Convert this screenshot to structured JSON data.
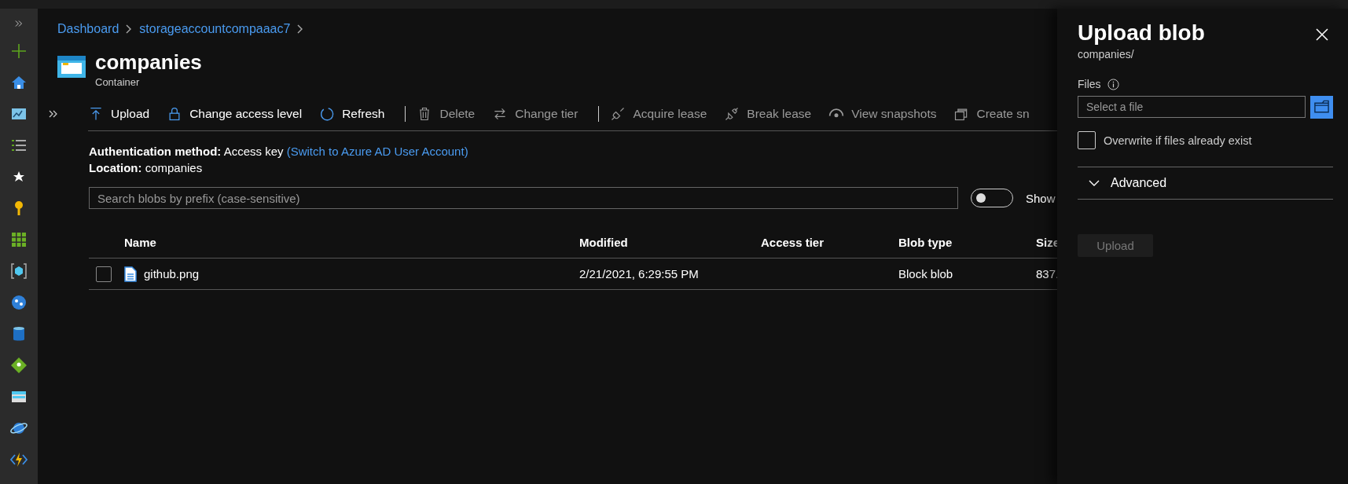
{
  "breadcrumb": [
    "Dashboard",
    "storageaccountcompaaac7"
  ],
  "header": {
    "title": "companies",
    "subtitle": "Container"
  },
  "toolbar": [
    {
      "label": "Upload",
      "disabled": false
    },
    {
      "label": "Change access level",
      "disabled": false
    },
    {
      "label": "Refresh",
      "disabled": false
    },
    {
      "label": "Delete",
      "disabled": true
    },
    {
      "label": "Change tier",
      "disabled": true
    },
    {
      "label": "Acquire lease",
      "disabled": true
    },
    {
      "label": "Break lease",
      "disabled": true
    },
    {
      "label": "View snapshots",
      "disabled": true
    },
    {
      "label": "Create sn",
      "disabled": true
    }
  ],
  "info": {
    "auth_label": "Authentication method:",
    "auth_value": "Access key",
    "auth_link": "(Switch to Azure AD User Account)",
    "location_label": "Location:",
    "location_value": "companies"
  },
  "search": {
    "placeholder": "Search blobs by prefix (case-sensitive)"
  },
  "toggle": {
    "label": "Show",
    "on": false
  },
  "table": {
    "columns": [
      "Name",
      "Modified",
      "Access tier",
      "Blob type",
      "Size"
    ],
    "rows": [
      {
        "checked": false,
        "cells": [
          "github.png",
          "2/21/2021, 6:29:55 PM",
          "",
          "Block blob",
          "837."
        ]
      }
    ]
  },
  "panel": {
    "title": "Upload blob",
    "subtitle": "companies/",
    "files_label": "Files",
    "file_placeholder": "Select a file",
    "overwrite": {
      "label": "Overwrite if files already exist",
      "checked": false
    },
    "advanced": {
      "label": "Advanced",
      "expanded": false
    },
    "upload_button": {
      "label": "Upload",
      "disabled": true
    }
  }
}
